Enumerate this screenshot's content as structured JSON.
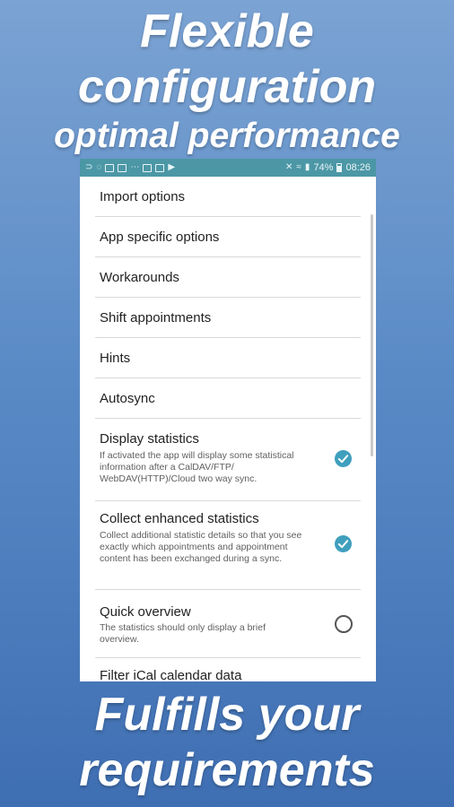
{
  "promo": {
    "top_line1": "Flexible",
    "top_line2": "configuration",
    "top_line3": "optimal performance",
    "bottom_line1": "Fulfills your",
    "bottom_line2": "requirements"
  },
  "statusbar": {
    "battery": "74%",
    "time": "08:26"
  },
  "settings": {
    "items": [
      {
        "title": "Import options"
      },
      {
        "title": "App specific options"
      },
      {
        "title": "Workarounds"
      },
      {
        "title": "Shift appointments"
      },
      {
        "title": "Hints"
      },
      {
        "title": "Autosync"
      },
      {
        "title": "Display statistics",
        "summary": "If activated the app will display some statistical information after a CalDAV/FTP/ WebDAV(HTTP)/Cloud two way sync.",
        "checked": true
      },
      {
        "title": "Collect enhanced statistics",
        "summary": "Collect additional statistic details so that you see exactly which appointments and appointment content has been exchanged during a sync.",
        "checked": true
      },
      {
        "title": "Quick overview",
        "summary": "The statistics should only display a brief overview.",
        "checked": false
      },
      {
        "title": "Filter iCal calendar data"
      }
    ]
  },
  "colors": {
    "statusbar": "#4c97a6",
    "checkbox_accent": "#3f9fbd"
  }
}
